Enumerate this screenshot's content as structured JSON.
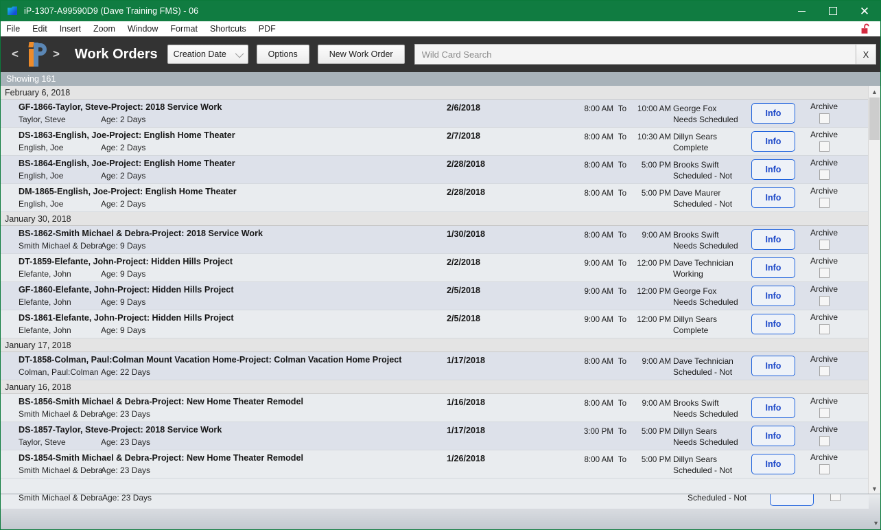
{
  "window": {
    "title": "iP-1307-A99590D9 (Dave Training FMS) - 06",
    "icon": "folder-icon",
    "minimize": "–",
    "maximize": "□",
    "close": "✕"
  },
  "menubar": {
    "items": [
      "File",
      "Edit",
      "Insert",
      "Zoom",
      "Window",
      "Format",
      "Shortcuts",
      "PDF"
    ],
    "lock_icon": "unlock-icon",
    "lock_color": "#d42a40"
  },
  "toolbar": {
    "prev": "<",
    "next": ">",
    "logo": "ip-logo",
    "heading": "Work Orders",
    "sort_select": "Creation Date",
    "options_label": "Options",
    "new_work_order_label": "New Work Order",
    "search_placeholder": "Wild Card Search",
    "search_value": "",
    "search_clear_label": "X",
    "background": "#333333"
  },
  "status": {
    "showing": "Showing 161",
    "bar_color": "#a8b2b9"
  },
  "labels": {
    "to": "To",
    "info": "Info",
    "archive": "Archive"
  },
  "groups": [
    {
      "date": "February 6, 2018",
      "rows": [
        {
          "title": "GF-1866-Taylor, Steve-Project: 2018 Service Work",
          "customer": "Taylor, Steve",
          "age": "Age: 2 Days",
          "date": "2/6/2018",
          "start": "8:00 AM",
          "end": "10:00 AM",
          "tech": "George  Fox",
          "statusText": "Needs Scheduled"
        },
        {
          "title": "DS-1863-English, Joe-Project: English Home Theater",
          "customer": "English, Joe",
          "age": "Age: 2 Days",
          "date": "2/7/2018",
          "start": "8:00 AM",
          "end": "10:30 AM",
          "tech": "Dillyn Sears",
          "statusText": "Complete"
        },
        {
          "title": "BS-1864-English, Joe-Project: English Home Theater",
          "customer": "English, Joe",
          "age": "Age: 2 Days",
          "date": "2/28/2018",
          "start": "8:00 AM",
          "end": "5:00 PM",
          "tech": "Brooks  Swift",
          "statusText": "Scheduled - Not"
        },
        {
          "title": "DM-1865-English, Joe-Project: English Home Theater",
          "customer": "English, Joe",
          "age": "Age: 2 Days",
          "date": "2/28/2018",
          "start": "8:00 AM",
          "end": "5:00 PM",
          "tech": "Dave  Maurer",
          "statusText": "Scheduled - Not"
        }
      ]
    },
    {
      "date": "January 30, 2018",
      "rows": [
        {
          "title": "BS-1862-Smith Michael & Debra-Project: 2018 Service Work",
          "customer": "Smith Michael & Debra",
          "age": "Age: 9 Days",
          "date": "1/30/2018",
          "start": "8:00 AM",
          "end": "9:00 AM",
          "tech": "Brooks  Swift",
          "statusText": "Needs Scheduled"
        },
        {
          "title": "DT-1859-Elefante, John-Project: Hidden Hills Project",
          "customer": "Elefante, John",
          "age": "Age: 9 Days",
          "date": "2/2/2018",
          "start": "9:00 AM",
          "end": "12:00 PM",
          "tech": "Dave Technician",
          "statusText": "Working"
        },
        {
          "title": "GF-1860-Elefante, John-Project: Hidden Hills Project",
          "customer": "Elefante, John",
          "age": "Age: 9 Days",
          "date": "2/5/2018",
          "start": "9:00 AM",
          "end": "12:00 PM",
          "tech": "George  Fox",
          "statusText": "Needs Scheduled"
        },
        {
          "title": "DS-1861-Elefante, John-Project: Hidden Hills Project",
          "customer": "Elefante, John",
          "age": "Age: 9 Days",
          "date": "2/5/2018",
          "start": "9:00 AM",
          "end": "12:00 PM",
          "tech": "Dillyn Sears",
          "statusText": "Complete"
        }
      ]
    },
    {
      "date": "January 17, 2018",
      "rows": [
        {
          "title": "DT-1858-Colman, Paul:Colman Mount Vacation Home-Project: Colman Vacation Home Project",
          "customer": "Colman, Paul:Colman",
          "age": "Age: 22 Days",
          "date": "1/17/2018",
          "start": "8:00 AM",
          "end": "9:00 AM",
          "tech": "Dave Technician",
          "statusText": "Scheduled - Not"
        }
      ]
    },
    {
      "date": "January 16, 2018",
      "rows": [
        {
          "title": "BS-1856-Smith Michael & Debra-Project: New Home Theater Remodel",
          "customer": "Smith Michael & Debra",
          "age": "Age: 23 Days",
          "date": "1/16/2018",
          "start": "8:00 AM",
          "end": "9:00 AM",
          "tech": "Brooks  Swift",
          "statusText": "Needs Scheduled"
        },
        {
          "title": "DS-1857-Taylor, Steve-Project: 2018 Service Work",
          "customer": "Taylor, Steve",
          "age": "Age: 23 Days",
          "date": "1/17/2018",
          "start": "3:00 PM",
          "end": "5:00 PM",
          "tech": "Dillyn Sears",
          "statusText": "Needs Scheduled"
        },
        {
          "title": "DS-1854-Smith Michael & Debra-Project: New Home Theater Remodel",
          "customer": "Smith Michael & Debra",
          "age": "Age: 23 Days",
          "date": "1/26/2018",
          "start": "8:00 AM",
          "end": "5:00 PM",
          "tech": "Dillyn Sears",
          "statusText": "Scheduled - Not"
        }
      ]
    }
  ],
  "partial_row": {
    "customer": "Smith Michael & Debra",
    "age": "Age: 23 Days",
    "statusText": "Scheduled - Not"
  },
  "scrollbar": {
    "up_arrow": "▲",
    "down_arrow": "▼"
  }
}
